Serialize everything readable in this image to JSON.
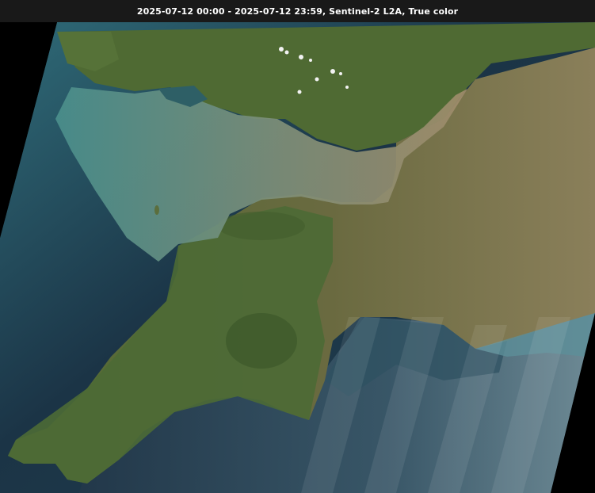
{
  "caption": {
    "text": "2025-07-12 00:00 - 2025-07-12 23:59, Sentinel-2 L2A, True color"
  },
  "imagery": {
    "kind": "satellite-true-color",
    "colors": {
      "nodata": "#000000",
      "deep_sea": "#1b3446",
      "coastal_sea": "#2f6b78",
      "turquoise_water": "#4a8f8c",
      "estuary_sediment": "#9a8a6c",
      "land_green": "#4f6a33",
      "land_tan": "#8a7f5a",
      "cloud": "#f2f2f2"
    }
  }
}
